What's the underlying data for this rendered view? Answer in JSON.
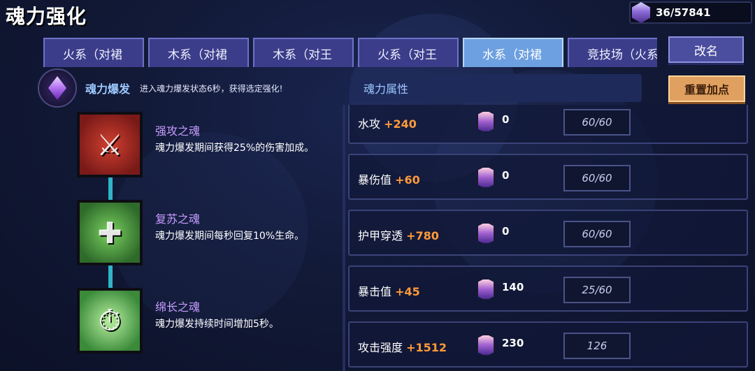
{
  "header": {
    "title": "魂力强化",
    "currency": "36/57841"
  },
  "tabs": [
    {
      "label": "火系（对裙",
      "active": false
    },
    {
      "label": "木系（对裙",
      "active": false
    },
    {
      "label": "木系（对王",
      "active": false
    },
    {
      "label": "火系（对王",
      "active": false
    },
    {
      "label": "水系（对裙",
      "active": true
    },
    {
      "label": "竞技场（火系",
      "active": false
    }
  ],
  "buttons": {
    "rename": "改名",
    "reset": "重置加点"
  },
  "burst": {
    "label": "魂力爆发",
    "description": "进入魂力爆发状态6秒，获得选定强化!"
  },
  "souls": [
    {
      "name": "强攻之魂",
      "description": "魂力爆发期间获得25%的伤害加成。",
      "icon": "red-sword-soul-icon"
    },
    {
      "name": "复苏之魂",
      "description": "魂力爆发期间每秒回复10%生命。",
      "icon": "green-heal-soul-icon"
    },
    {
      "name": "绵长之魂",
      "description": "魂力爆发持续时间增加5秒。",
      "icon": "clock-soul-icon"
    }
  ],
  "attributes": {
    "header": "魂力属性",
    "rows": [
      {
        "name": "水攻",
        "bonus": "+240",
        "cost": "0",
        "progress": "60/60"
      },
      {
        "name": "暴伤值",
        "bonus": "+60",
        "cost": "0",
        "progress": "60/60"
      },
      {
        "name": "护甲穿透",
        "bonus": "+780",
        "cost": "0",
        "progress": "60/60"
      },
      {
        "name": "暴击值",
        "bonus": "+45",
        "cost": "140",
        "progress": "25/60"
      },
      {
        "name": "攻击强度",
        "bonus": "+1512",
        "cost": "230",
        "progress": "126"
      }
    ]
  }
}
